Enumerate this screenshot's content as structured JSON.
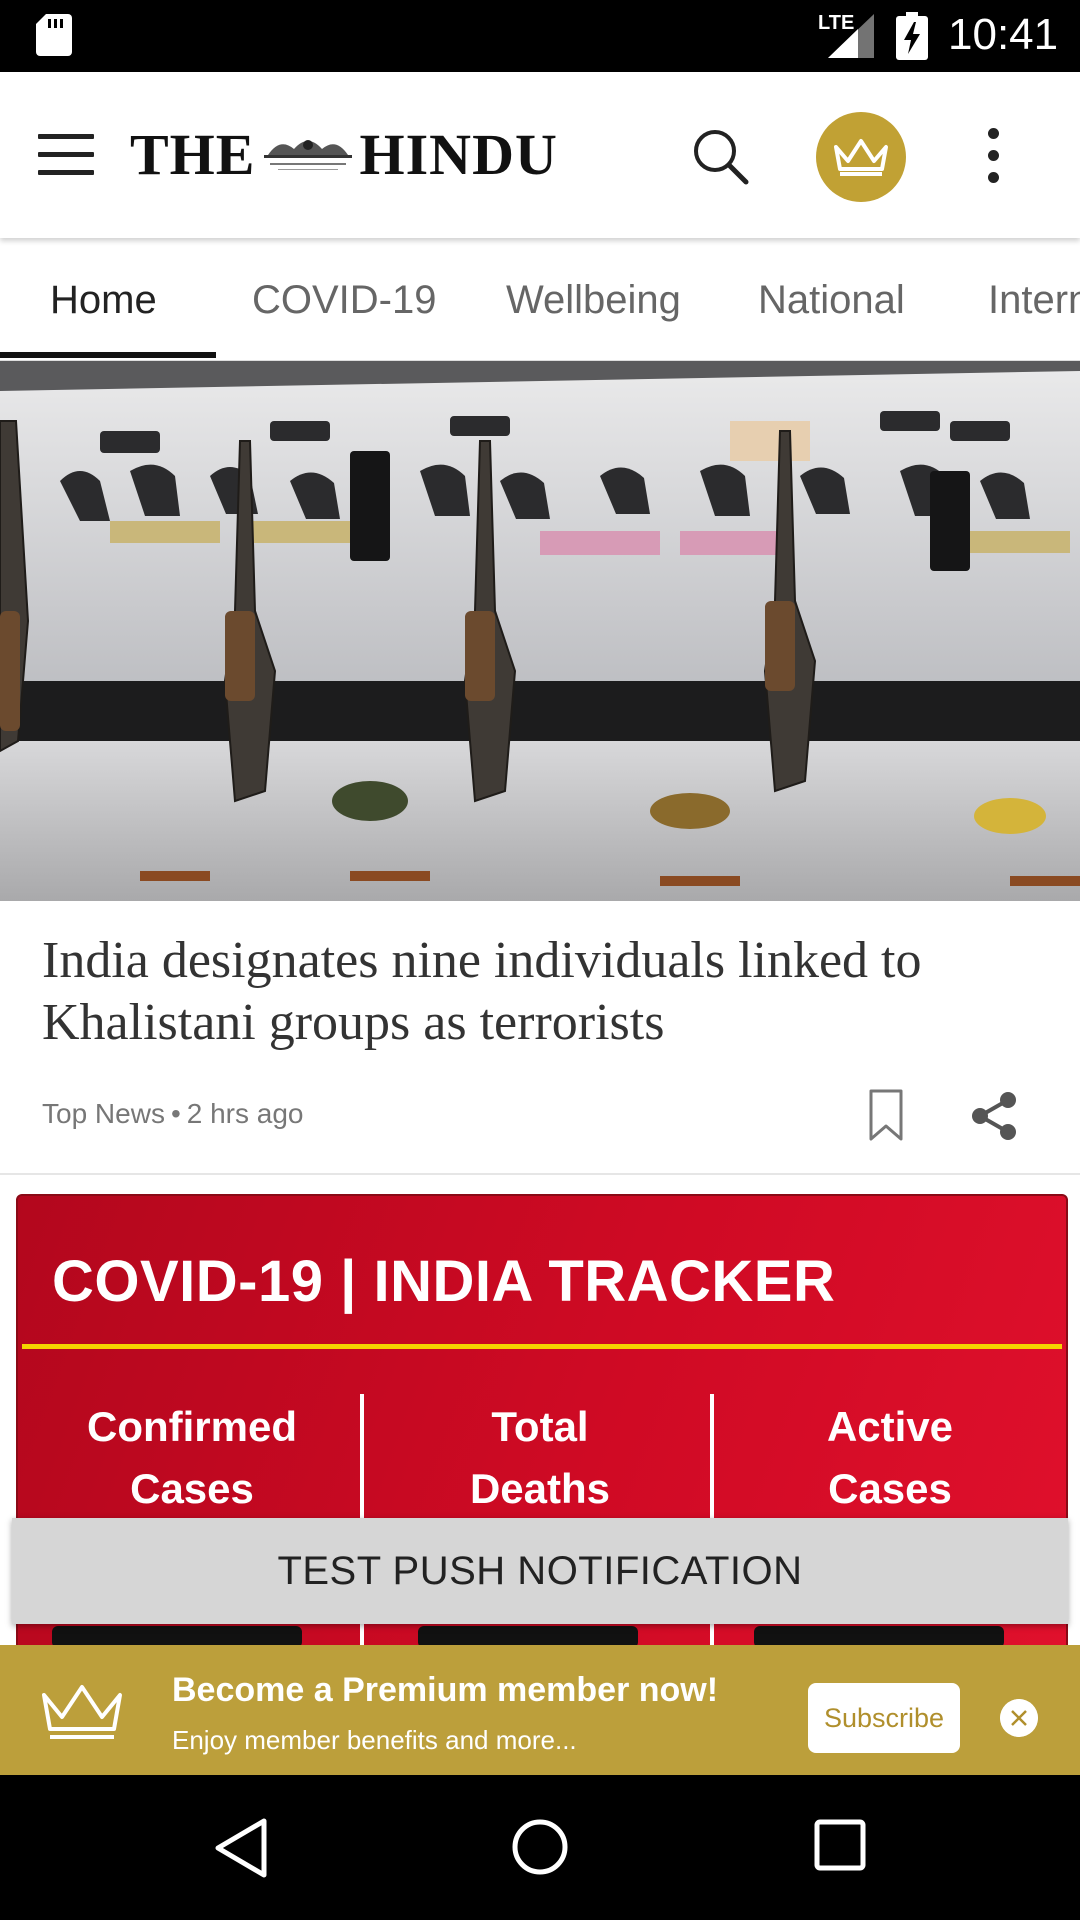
{
  "status_bar": {
    "network": "LTE",
    "time": "10:41",
    "icons": [
      "sd-card-icon",
      "signal-icon",
      "battery-charging-icon"
    ]
  },
  "app_bar": {
    "logo_left": "THE",
    "logo_right": "HINDU",
    "icons": [
      "menu-icon",
      "search-icon",
      "crown-icon",
      "more-vert-icon"
    ],
    "accent_color": "#c1a134"
  },
  "tabs": [
    {
      "label": "Home",
      "active": true
    },
    {
      "label": "COVID-19",
      "active": false
    },
    {
      "label": "Wellbeing",
      "active": false
    },
    {
      "label": "National",
      "active": false
    },
    {
      "label": "Intern",
      "active": false
    }
  ],
  "article": {
    "headline": "India designates nine individuals linked to Khalistani groups as terrorists",
    "section": "Top News",
    "separator": "•",
    "time_ago": "2 hrs ago"
  },
  "tracker": {
    "title": "COVID-19 | INDIA TRACKER",
    "columns": [
      {
        "line1": "Confirmed",
        "line2": "Cases"
      },
      {
        "line1": "Total",
        "line2": "Deaths"
      },
      {
        "line1": "Active",
        "line2": "Cases"
      }
    ],
    "colors": {
      "background": "#cf0a24",
      "rule": "#f5d300"
    }
  },
  "push_notification": {
    "label": "TEST PUSH NOTIFICATION"
  },
  "premium_banner": {
    "title": "Become a Premium member now!",
    "subtitle": "Enjoy member benefits and more...",
    "subscribe_label": "Subscribe",
    "background": "#bc9f3b"
  },
  "nav_bar": {
    "icons": [
      "back-icon",
      "home-icon",
      "recents-icon"
    ]
  }
}
